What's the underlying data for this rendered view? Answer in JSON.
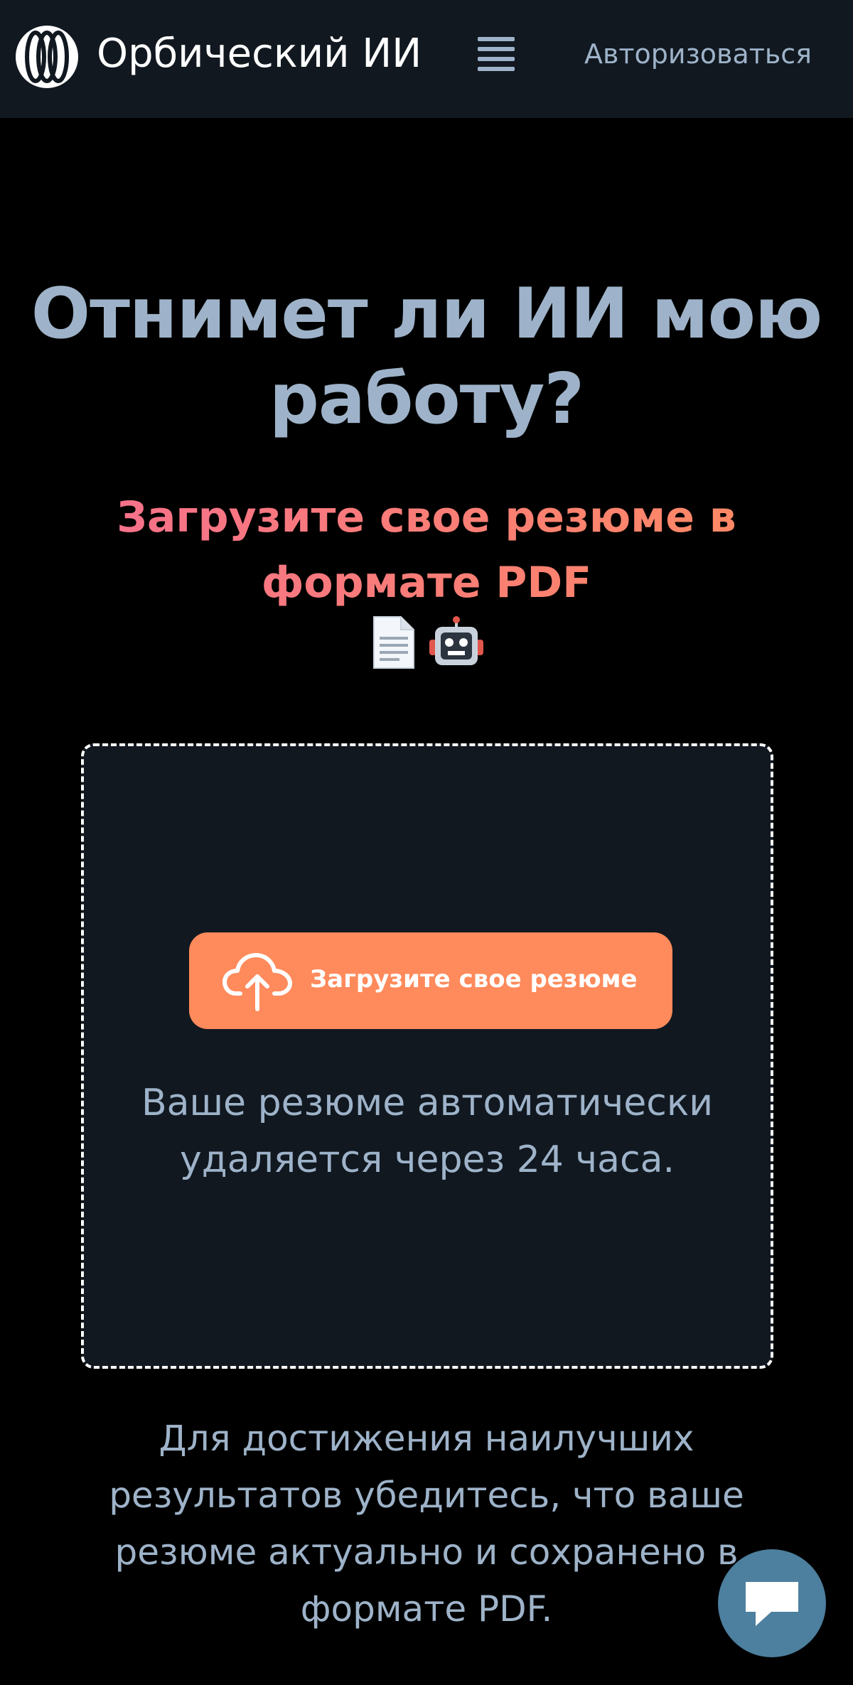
{
  "header": {
    "brand_name": "Орбический ИИ",
    "login_label": "Авторизоваться"
  },
  "hero": {
    "title": "Отнимет ли ИИ мою работу?",
    "subtitle": "Загрузите свое резюме в формате PDF",
    "emojis": [
      "document-icon",
      "robot-icon"
    ]
  },
  "dropzone": {
    "upload_label": "Загрузите свое резюме",
    "note": "Ваше резюме автоматически удаляется через 24 часа."
  },
  "tip": "Для достижения наилучших результатов убедитесь, что ваше резюме актуально и сохранено в формате PDF.",
  "colors": {
    "background": "#000000",
    "header_bg": "#111820",
    "text_muted": "#9eb3c9",
    "accent_orange": "#ff8a5b",
    "accent_pink": "#f5708c",
    "chat_bg": "#4d7f9e"
  }
}
